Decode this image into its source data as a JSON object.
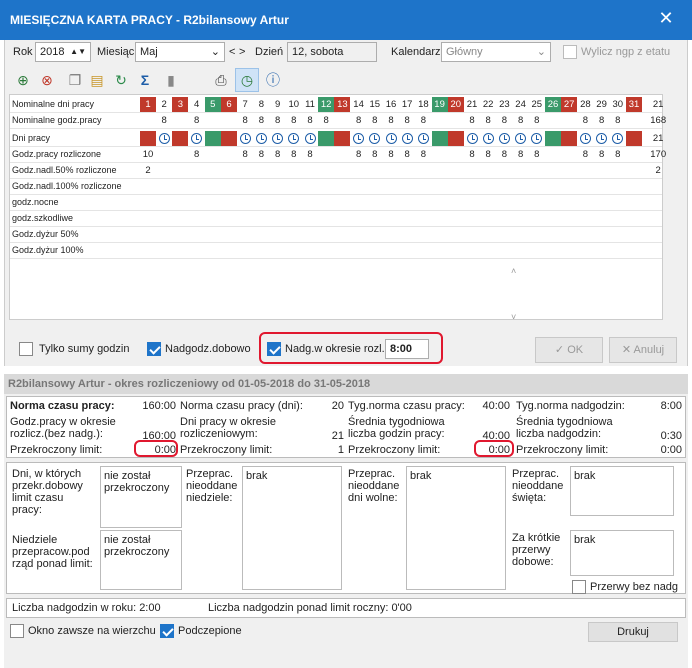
{
  "window": {
    "title": "MIESIĘCZNA KARTA PRACY - R2bilansowy Artur",
    "close": "✕"
  },
  "top": {
    "rok_label": "Rok",
    "rok": "2018",
    "miesiac_label": "Miesiąc",
    "miesiac": "Maj",
    "nav_prev": "<",
    "nav_next": ">",
    "dzien_label": "Dzień",
    "dzien": "12, sobota",
    "kalendarz_label": "Kalendarz",
    "kalendarz": "Główny",
    "wylicz_label": "Wylicz ngp z etatu"
  },
  "grid": {
    "rows": [
      "Nominalne dni pracy",
      "Nominalne godz.pracy",
      "Dni pracy",
      "Godz.pracy rozliczone",
      "Godz.nadl.50% rozliczone",
      "Godz.nadl.100% rozliczone",
      "godz.nocne",
      "godz.szkodliwe",
      "Godz.dyżur 50%",
      "Godz.dyżur 100%"
    ],
    "days": [
      "1",
      "2",
      "3",
      "4",
      "5",
      "6",
      "7",
      "8",
      "9",
      "10",
      "11",
      "12",
      "13",
      "14",
      "15",
      "16",
      "17",
      "18",
      "19",
      "20",
      "21",
      "22",
      "23",
      "24",
      "25",
      "26",
      "27",
      "28",
      "29",
      "30",
      "31"
    ],
    "day_type": [
      "r",
      "n",
      "r",
      "n",
      "g",
      "r",
      "n",
      "n",
      "n",
      "n",
      "n",
      "g",
      "r",
      "n",
      "n",
      "n",
      "n",
      "n",
      "g",
      "r",
      "n",
      "n",
      "n",
      "n",
      "n",
      "g",
      "r",
      "n",
      "n",
      "n",
      "r"
    ],
    "nom_total": "21",
    "nom_godz": [
      "",
      "8",
      "",
      "8",
      "",
      "",
      "8",
      "8",
      "8",
      "8",
      "8",
      "8",
      "",
      "8",
      "8",
      "8",
      "8",
      "8",
      "",
      "",
      "8",
      "8",
      "8",
      "8",
      "8",
      "",
      "",
      "8",
      "8",
      "8",
      ""
    ],
    "nom_godz_total": "168",
    "dni_total": "21",
    "godz_rozl": [
      "10",
      "",
      "",
      "8",
      "",
      "",
      "8",
      "8",
      "8",
      "8",
      "8",
      "",
      "",
      "8",
      "8",
      "8",
      "8",
      "8",
      "",
      "",
      "8",
      "8",
      "8",
      "8",
      "8",
      "",
      "",
      "8",
      "8",
      "8",
      ""
    ],
    "godz_rozl_total": "170",
    "nadl50": [
      "2",
      "",
      "",
      "",
      "",
      "",
      "",
      "",
      "",
      "",
      "",
      "",
      "",
      "",
      "",
      "",
      "",
      "",
      "",
      "",
      "",
      "",
      "",
      "",
      "",
      "",
      "",
      "",
      "",
      "",
      ""
    ],
    "nadl50_total": "2"
  },
  "checks": {
    "tylko_sumy": "Tylko sumy godzin",
    "nadgodz_dobowo": "Nadgodz.dobowo",
    "nadg_okres": "Nadg.w okresie rozl.",
    "nadg_value": "8:00"
  },
  "buttons": {
    "ok": "OK",
    "anuluj": "Anuluj",
    "drukuj": "Drukuj"
  },
  "summary": {
    "header": "R2bilansowy Artur - okres rozliczeniowy od 01-05-2018 do 31-05-2018",
    "c1": {
      "l1": "Norma czasu pracy:",
      "v1": "160:00",
      "l2": "Godz.pracy w okresie rozlicz.(bez nadg.):",
      "v2": "160:00",
      "l3": "Przekroczony limit:",
      "v3": "0:00"
    },
    "c2": {
      "l1": "Norma czasu pracy (dni):",
      "v1": "20",
      "l2": "Dni pracy w okresie rozliczeniowym:",
      "v2": "21",
      "l3": "Przekroczony limit:",
      "v3": "1"
    },
    "c3": {
      "l1": "Tyg.norma czasu pracy:",
      "v1": "40:00",
      "l2": "Średnia tygodniowa liczba godzin pracy:",
      "v2": "40:00",
      "l3": "Przekroczony limit:",
      "v3": "0:00"
    },
    "c4": {
      "l1": "Tyg.norma nadgodzin:",
      "v1": "8:00",
      "l2": "Średnia tygodniowa liczba nadgodzin:",
      "v2": "0:30",
      "l3": "Przekroczony limit:",
      "v3": "0:00"
    }
  },
  "details": {
    "d1": "Dni, w których przekr.dobowy limit czasu pracy:",
    "d1v": "nie został przekroczony",
    "d2": "Niedziele przepracow.pod rząd ponad limit:",
    "d2v": "nie został przekroczony",
    "d3": "Przeprac. nieoddane niedziele:",
    "d3v": "brak",
    "d4": "Przeprac. nieoddane dni wolne:",
    "d4v": "brak",
    "d5": "Przeprac. nieoddane święta:",
    "d5v": "brak",
    "d6": "Za krótkie przerwy dobowe:",
    "d6v": "brak",
    "przerwy": "Przerwy bez nadg"
  },
  "footer": {
    "rok": "Liczba nadgodzin w roku: 2:00",
    "limit": "Liczba nadgodzin ponad limit roczny: 0'00",
    "zawsze": "Okno zawsze na wierzchu",
    "podczepione": "Podczepione"
  }
}
